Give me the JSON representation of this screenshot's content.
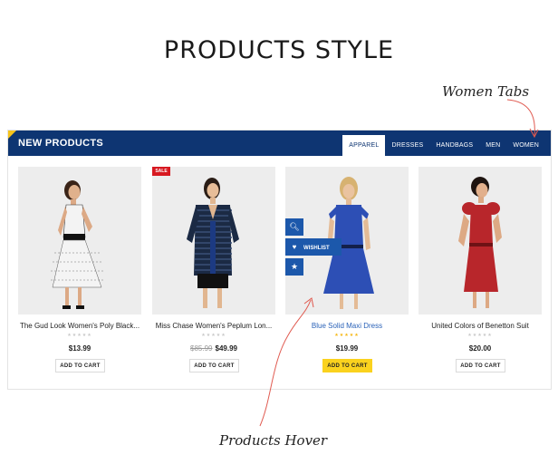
{
  "page": {
    "title": "PRODUCTS STYLE",
    "annotation_tabs": "Women Tabs",
    "annotation_hover": "Products Hover"
  },
  "module": {
    "title": "NEW PRODUCTS",
    "accent_color": "#f6c31a",
    "header_color": "#0e3572",
    "tabs": [
      {
        "label": "APPAREL",
        "active": true
      },
      {
        "label": "DRESSES",
        "active": false
      },
      {
        "label": "HANDBAGS",
        "active": false
      },
      {
        "label": "MEN",
        "active": false
      },
      {
        "label": "WOMEN",
        "active": false
      }
    ]
  },
  "products": [
    {
      "name": "The Gud Look Women's Poly Black...",
      "price": "$13.99",
      "old_price": "",
      "rating_stars": 0,
      "button": "ADD TO CART",
      "badge": "",
      "dress_color": "#f2f2f2"
    },
    {
      "name": "Miss Chase Women's Peplum Lon...",
      "price": "$49.99",
      "old_price": "$85.99",
      "rating_stars": 0,
      "button": "ADD TO CART",
      "badge": "SALE",
      "dress_color": "#1b2a44"
    },
    {
      "name": "Blue Solid Maxi Dress",
      "price": "$19.99",
      "old_price": "",
      "rating_stars": 5,
      "button": "ADD TO CART",
      "badge": "",
      "dress_color": "#2d4fb5",
      "hover": true,
      "hover_actions": {
        "quickview_icon": "zoom-icon",
        "wishlist_label": "WISHLIST",
        "wishlist_icon": "heart-icon",
        "compare_icon": "star-icon"
      }
    },
    {
      "name": "United Colors of Benetton Suit",
      "price": "$20.00",
      "old_price": "",
      "rating_stars": 0,
      "button": "ADD TO CART",
      "badge": "",
      "dress_color": "#b8262b"
    }
  ]
}
